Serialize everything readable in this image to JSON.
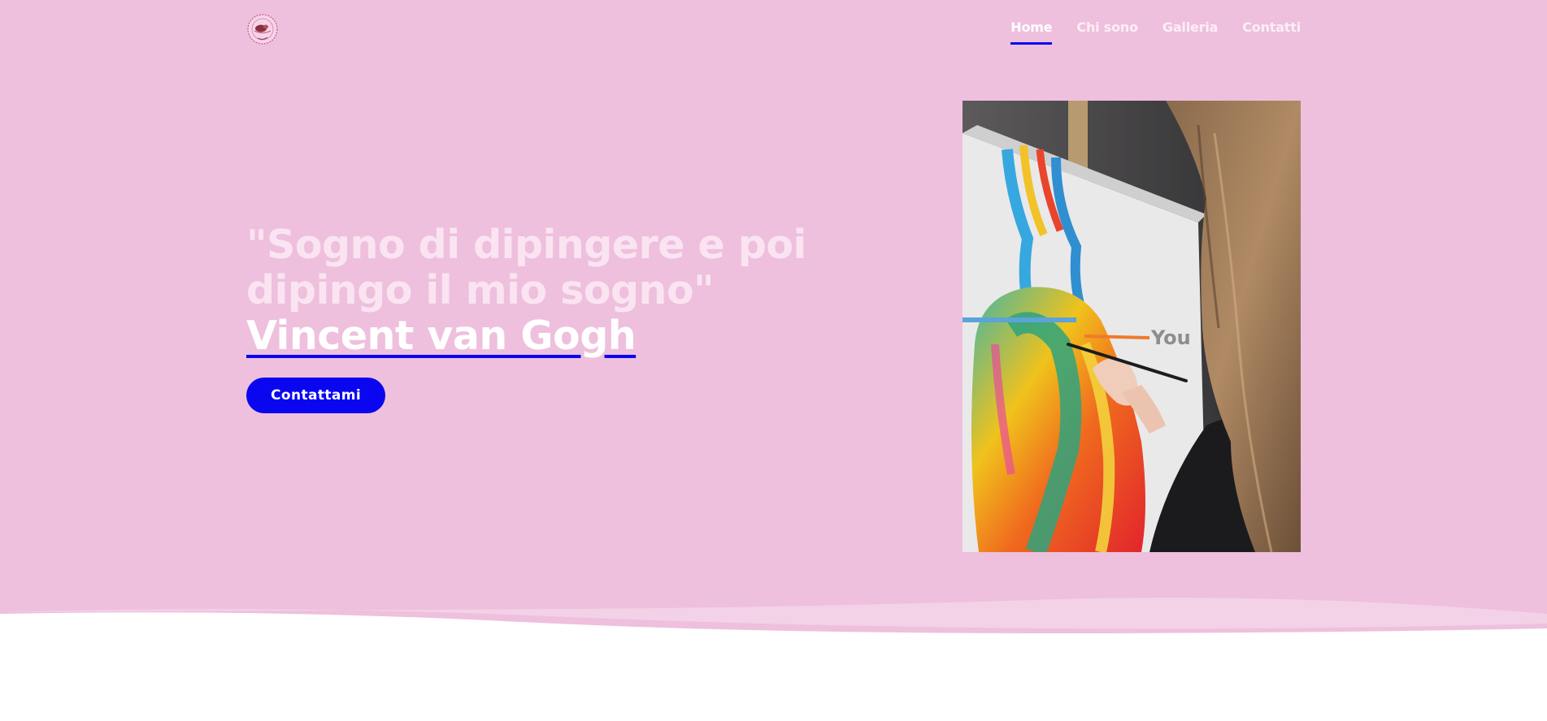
{
  "header": {
    "logo_name": "studio-logo",
    "nav": [
      {
        "label": "Home",
        "active": true
      },
      {
        "label": "Chi sono",
        "active": false
      },
      {
        "label": "Galleria",
        "active": false
      },
      {
        "label": "Contatti",
        "active": false
      }
    ]
  },
  "hero": {
    "quote": "\"Sogno di dipingere e poi dipingo il mio sogno\"",
    "author": "Vincent van Gogh",
    "cta_label": "Contattami",
    "photo_canvas_text": "You"
  },
  "colors": {
    "hero_background": "#eec0dd",
    "accent": "#0a07f0",
    "headline": "#fbe4f1"
  }
}
